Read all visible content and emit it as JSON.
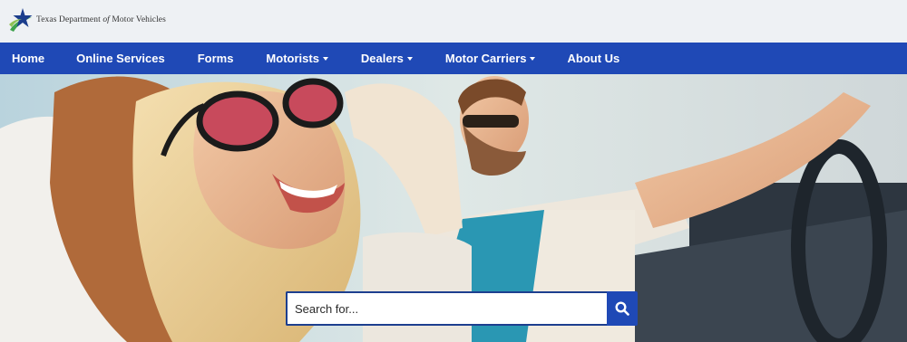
{
  "header": {
    "logo_text_pre": "Texas Department ",
    "logo_text_of": "of",
    "logo_text_post": " Motor Vehicles"
  },
  "nav": {
    "items": [
      {
        "label": "Home"
      },
      {
        "label": "Online Services"
      },
      {
        "label": "Forms"
      },
      {
        "label": "Motorists",
        "dropdown": true
      },
      {
        "label": "Dealers",
        "dropdown": true
      },
      {
        "label": "Motor Carriers",
        "dropdown": true
      },
      {
        "label": "About Us"
      }
    ]
  },
  "search": {
    "placeholder": "Search for...",
    "icon": "magnifier-icon"
  },
  "colors": {
    "nav_bg": "#1f49b6",
    "top_bg": "#eef1f4",
    "search_border": "#1d3f8f"
  }
}
